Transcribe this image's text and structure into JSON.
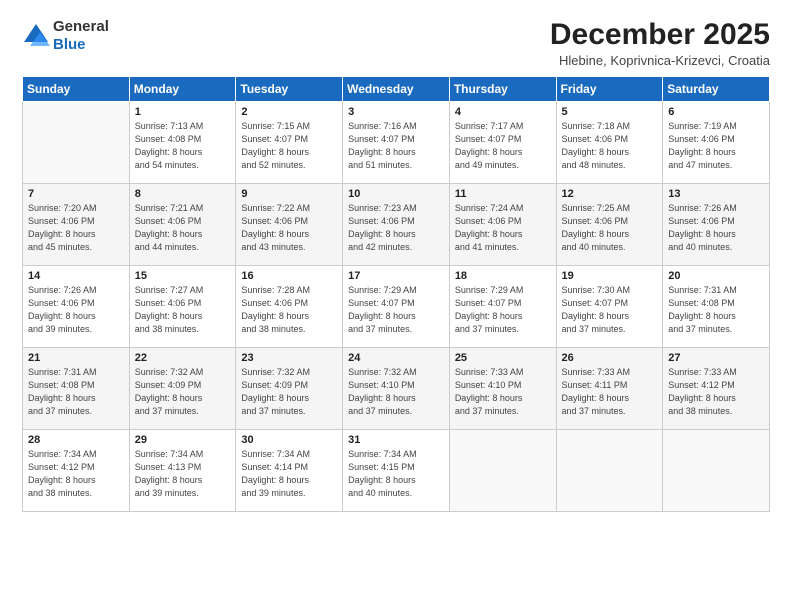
{
  "logo": {
    "line1": "General",
    "line2": "Blue"
  },
  "title": "December 2025",
  "location": "Hlebine, Koprivnica-Krizevci, Croatia",
  "weekdays": [
    "Sunday",
    "Monday",
    "Tuesday",
    "Wednesday",
    "Thursday",
    "Friday",
    "Saturday"
  ],
  "weeks": [
    [
      {
        "day": "",
        "info": ""
      },
      {
        "day": "1",
        "info": "Sunrise: 7:13 AM\nSunset: 4:08 PM\nDaylight: 8 hours\nand 54 minutes."
      },
      {
        "day": "2",
        "info": "Sunrise: 7:15 AM\nSunset: 4:07 PM\nDaylight: 8 hours\nand 52 minutes."
      },
      {
        "day": "3",
        "info": "Sunrise: 7:16 AM\nSunset: 4:07 PM\nDaylight: 8 hours\nand 51 minutes."
      },
      {
        "day": "4",
        "info": "Sunrise: 7:17 AM\nSunset: 4:07 PM\nDaylight: 8 hours\nand 49 minutes."
      },
      {
        "day": "5",
        "info": "Sunrise: 7:18 AM\nSunset: 4:06 PM\nDaylight: 8 hours\nand 48 minutes."
      },
      {
        "day": "6",
        "info": "Sunrise: 7:19 AM\nSunset: 4:06 PM\nDaylight: 8 hours\nand 47 minutes."
      }
    ],
    [
      {
        "day": "7",
        "info": "Sunrise: 7:20 AM\nSunset: 4:06 PM\nDaylight: 8 hours\nand 45 minutes."
      },
      {
        "day": "8",
        "info": "Sunrise: 7:21 AM\nSunset: 4:06 PM\nDaylight: 8 hours\nand 44 minutes."
      },
      {
        "day": "9",
        "info": "Sunrise: 7:22 AM\nSunset: 4:06 PM\nDaylight: 8 hours\nand 43 minutes."
      },
      {
        "day": "10",
        "info": "Sunrise: 7:23 AM\nSunset: 4:06 PM\nDaylight: 8 hours\nand 42 minutes."
      },
      {
        "day": "11",
        "info": "Sunrise: 7:24 AM\nSunset: 4:06 PM\nDaylight: 8 hours\nand 41 minutes."
      },
      {
        "day": "12",
        "info": "Sunrise: 7:25 AM\nSunset: 4:06 PM\nDaylight: 8 hours\nand 40 minutes."
      },
      {
        "day": "13",
        "info": "Sunrise: 7:26 AM\nSunset: 4:06 PM\nDaylight: 8 hours\nand 40 minutes."
      }
    ],
    [
      {
        "day": "14",
        "info": "Sunrise: 7:26 AM\nSunset: 4:06 PM\nDaylight: 8 hours\nand 39 minutes."
      },
      {
        "day": "15",
        "info": "Sunrise: 7:27 AM\nSunset: 4:06 PM\nDaylight: 8 hours\nand 38 minutes."
      },
      {
        "day": "16",
        "info": "Sunrise: 7:28 AM\nSunset: 4:06 PM\nDaylight: 8 hours\nand 38 minutes."
      },
      {
        "day": "17",
        "info": "Sunrise: 7:29 AM\nSunset: 4:07 PM\nDaylight: 8 hours\nand 37 minutes."
      },
      {
        "day": "18",
        "info": "Sunrise: 7:29 AM\nSunset: 4:07 PM\nDaylight: 8 hours\nand 37 minutes."
      },
      {
        "day": "19",
        "info": "Sunrise: 7:30 AM\nSunset: 4:07 PM\nDaylight: 8 hours\nand 37 minutes."
      },
      {
        "day": "20",
        "info": "Sunrise: 7:31 AM\nSunset: 4:08 PM\nDaylight: 8 hours\nand 37 minutes."
      }
    ],
    [
      {
        "day": "21",
        "info": "Sunrise: 7:31 AM\nSunset: 4:08 PM\nDaylight: 8 hours\nand 37 minutes."
      },
      {
        "day": "22",
        "info": "Sunrise: 7:32 AM\nSunset: 4:09 PM\nDaylight: 8 hours\nand 37 minutes."
      },
      {
        "day": "23",
        "info": "Sunrise: 7:32 AM\nSunset: 4:09 PM\nDaylight: 8 hours\nand 37 minutes."
      },
      {
        "day": "24",
        "info": "Sunrise: 7:32 AM\nSunset: 4:10 PM\nDaylight: 8 hours\nand 37 minutes."
      },
      {
        "day": "25",
        "info": "Sunrise: 7:33 AM\nSunset: 4:10 PM\nDaylight: 8 hours\nand 37 minutes."
      },
      {
        "day": "26",
        "info": "Sunrise: 7:33 AM\nSunset: 4:11 PM\nDaylight: 8 hours\nand 37 minutes."
      },
      {
        "day": "27",
        "info": "Sunrise: 7:33 AM\nSunset: 4:12 PM\nDaylight: 8 hours\nand 38 minutes."
      }
    ],
    [
      {
        "day": "28",
        "info": "Sunrise: 7:34 AM\nSunset: 4:12 PM\nDaylight: 8 hours\nand 38 minutes."
      },
      {
        "day": "29",
        "info": "Sunrise: 7:34 AM\nSunset: 4:13 PM\nDaylight: 8 hours\nand 39 minutes."
      },
      {
        "day": "30",
        "info": "Sunrise: 7:34 AM\nSunset: 4:14 PM\nDaylight: 8 hours\nand 39 minutes."
      },
      {
        "day": "31",
        "info": "Sunrise: 7:34 AM\nSunset: 4:15 PM\nDaylight: 8 hours\nand 40 minutes."
      },
      {
        "day": "",
        "info": ""
      },
      {
        "day": "",
        "info": ""
      },
      {
        "day": "",
        "info": ""
      }
    ]
  ]
}
